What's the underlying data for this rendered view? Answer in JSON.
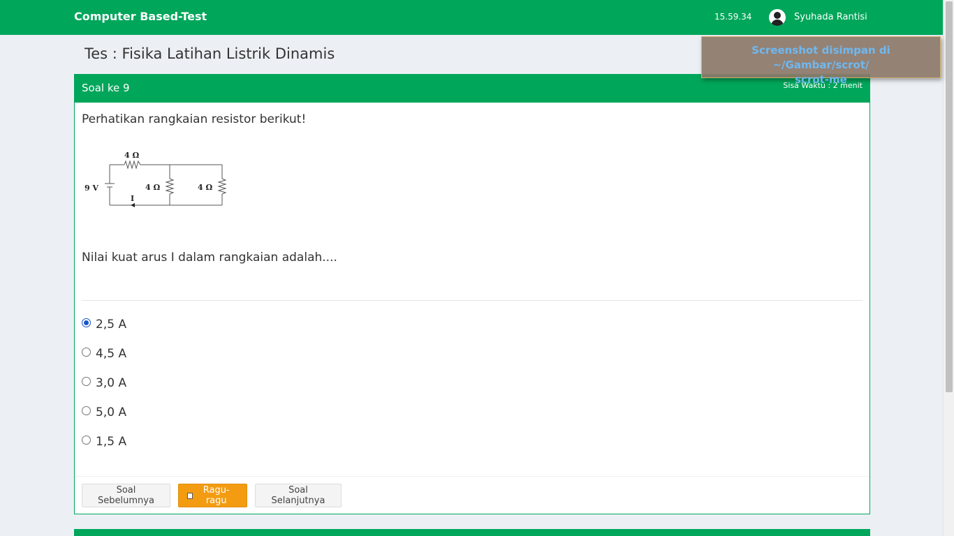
{
  "navbar": {
    "brand": "Computer Based-Test",
    "time": "15.59.34",
    "user_name": "Syuhada Rantisi"
  },
  "page": {
    "title": "Tes : Fisika Latihan Listrik Dinamis"
  },
  "question": {
    "header": "Soal ke 9",
    "timer": "Sisa Waktu : 2 menit",
    "prompt": "Perhatikan rangkaian resistor berikut!",
    "circuit": {
      "source": "9 V",
      "r_top": "4 Ω",
      "r_mid": "4 Ω",
      "r_right": "4 Ω",
      "current": "I"
    },
    "ask": "Nilai kuat arus I dalam rangkaian adalah....",
    "options": [
      {
        "label": "2,5 A",
        "selected": true
      },
      {
        "label": "4,5 A",
        "selected": false
      },
      {
        "label": "3,0 A",
        "selected": false
      },
      {
        "label": "5,0 A",
        "selected": false
      },
      {
        "label": "1,5 A",
        "selected": false
      }
    ]
  },
  "buttons": {
    "prev": "Soal Sebelumnya",
    "ragu": "Ragu-ragu",
    "next": "Soal Selanjutnya"
  },
  "notification": {
    "line1": "Screenshot disimpan di ~/Gambar/scrot/",
    "line2": "scrot-me"
  },
  "colors": {
    "primary": "#00a65a",
    "warning": "#f39c12",
    "background": "#ecf0f5"
  }
}
